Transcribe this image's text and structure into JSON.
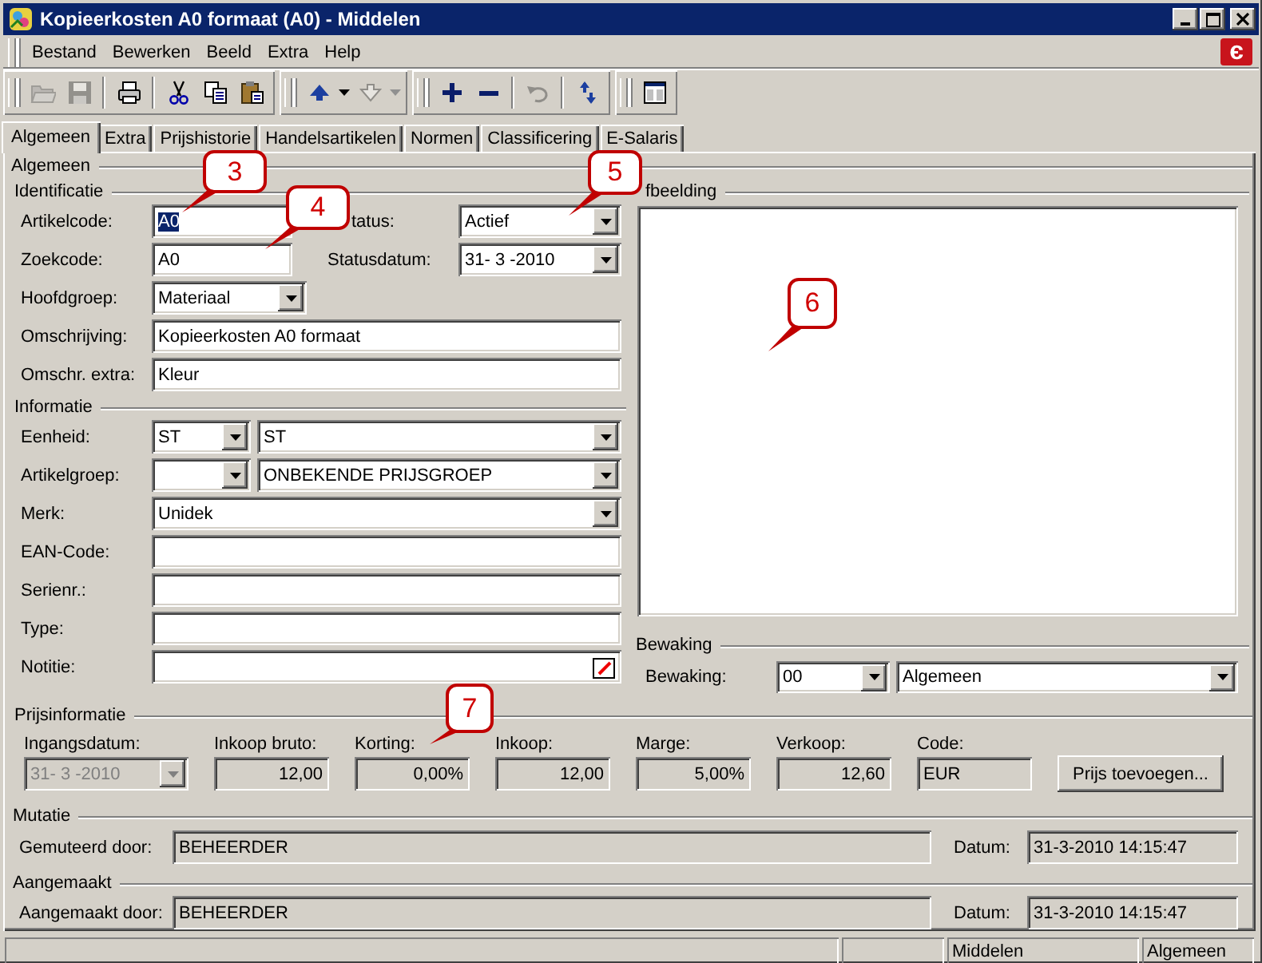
{
  "window": {
    "title": "Kopieerkosten A0 formaat (A0) - Middelen"
  },
  "menu": [
    "Bestand",
    "Bewerken",
    "Beeld",
    "Extra",
    "Help"
  ],
  "logo": "є",
  "toolbar": [
    [
      [
        {
          "kind": "open",
          "disabled": true
        },
        {
          "kind": "save",
          "disabled": true
        }
      ],
      [
        {
          "kind": "print",
          "disabled": false
        }
      ],
      [
        {
          "kind": "cut",
          "disabled": false
        },
        {
          "kind": "copy",
          "disabled": false
        },
        {
          "kind": "paste",
          "disabled": false
        }
      ]
    ],
    [
      [
        {
          "kind": "up",
          "disabled": false
        },
        {
          "kind": "down",
          "disabled": true
        }
      ]
    ],
    [
      [
        {
          "kind": "add",
          "disabled": false
        },
        {
          "kind": "remove",
          "disabled": false
        }
      ],
      [
        {
          "kind": "undo",
          "disabled": true
        }
      ],
      [
        {
          "kind": "refresh",
          "disabled": false
        }
      ]
    ],
    [
      [
        {
          "kind": "window",
          "disabled": false
        }
      ]
    ]
  ],
  "tabs": [
    {
      "label": "Algemeen",
      "selected": true
    },
    {
      "label": "Extra",
      "selected": false
    },
    {
      "label": "Prijshistorie",
      "selected": false
    },
    {
      "label": "Handelsartikelen",
      "selected": false
    },
    {
      "label": "Normen",
      "selected": false
    },
    {
      "label": "Classificering",
      "selected": false
    },
    {
      "label": "E-Salaris",
      "selected": false
    }
  ],
  "section_title": "Algemeen",
  "identification": {
    "title": "Identificatie",
    "fields": [
      {
        "label": "Artikelcode:",
        "value": "A0",
        "kind": "edit",
        "text_selected": true
      },
      {
        "label": "Zoekcode:",
        "value": "A0",
        "kind": "edit",
        "text_selected": false
      },
      {
        "label": "Hoofdgroep:",
        "value": "Materiaal",
        "kind": "combo",
        "text_selected": false
      },
      {
        "label": "Omschrijving:",
        "value": "Kopieerkosten A0 formaat",
        "kind": "edit",
        "text_selected": false
      },
      {
        "label": "Omschr. extra:",
        "value": "Kleur",
        "kind": "edit",
        "text_selected": false
      }
    ],
    "status": {
      "label": "tatus:",
      "value": "Actief"
    },
    "status_date": {
      "label": "Statusdatum:",
      "value": "31- 3 -2010"
    }
  },
  "information": {
    "title": "Informatie",
    "fields": [
      {
        "label": "Eenheid:",
        "kind": "double_combo",
        "code": "ST",
        "value": "ST"
      },
      {
        "label": "Artikelgroep:",
        "kind": "double_combo",
        "value": "ONBEKENDE PRIJSGROEP"
      },
      {
        "label": "Merk:",
        "kind": "combo",
        "value": "Unidek"
      },
      {
        "label": "EAN-Code:",
        "kind": "edit"
      },
      {
        "label": "Serienr.:",
        "kind": "edit"
      },
      {
        "label": "Type:",
        "kind": "edit"
      },
      {
        "label": "Notitie:",
        "kind": "note"
      }
    ]
  },
  "image": {
    "title": "fbeelding"
  },
  "monitoring": {
    "title": "Bewaking",
    "label": "Bewaking:",
    "code": "00",
    "value": "Algemeen"
  },
  "price_info": {
    "title": "Prijsinformatie",
    "fields": [
      {
        "label": "Ingangsdatum:",
        "value": "31- 3 -2010",
        "kind": "combo",
        "disabled": true
      },
      {
        "label": "Inkoop bruto:",
        "value": "12,00",
        "kind": "number",
        "disabled": false
      },
      {
        "label": "Korting:",
        "value": "0,00%",
        "kind": "number",
        "disabled": false
      },
      {
        "label": "Inkoop:",
        "value": "12,00",
        "kind": "number",
        "disabled": false
      },
      {
        "label": "Marge:",
        "value": "5,00%",
        "kind": "number",
        "disabled": false
      },
      {
        "label": "Verkoop:",
        "value": "12,60",
        "kind": "number",
        "disabled": false
      },
      {
        "label": "Code:",
        "value": "EUR",
        "kind": "text",
        "disabled": false
      }
    ],
    "button": "Prijs toevoegen..."
  },
  "mutation": {
    "title": "Mutatie",
    "label": "Gemuteerd door:",
    "value": "BEHEERDER",
    "date_label": "Datum:",
    "date": "31-3-2010 14:15:47"
  },
  "created": {
    "title": "Aangemaakt",
    "label": "Aangemaakt door:",
    "value": "BEHEERDER",
    "date_label": "Datum:",
    "date": "31-3-2010 14:15:47"
  },
  "status_bar": [
    "Middelen",
    "Algemeen"
  ],
  "callouts": [
    "3",
    "4",
    "5",
    "6",
    "7"
  ]
}
